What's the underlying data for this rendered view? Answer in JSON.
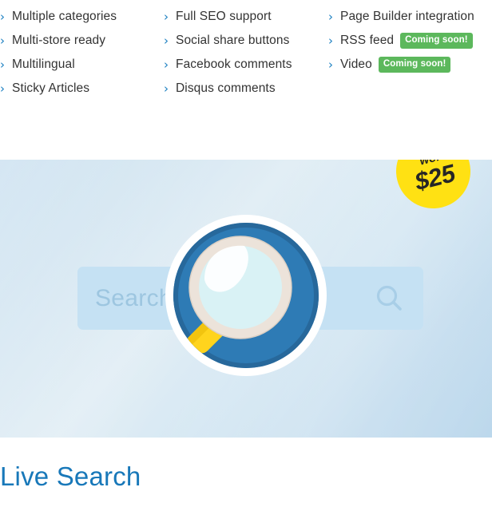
{
  "features": {
    "columns": [
      {
        "items": [
          {
            "label": "Multiple categories",
            "chevron": "›",
            "badge": ""
          },
          {
            "label": "Multi-store ready",
            "chevron": "›",
            "badge": ""
          },
          {
            "label": "Multilingual",
            "chevron": "›",
            "badge": ""
          },
          {
            "label": "Sticky Articles",
            "chevron": "›",
            "badge": ""
          }
        ]
      },
      {
        "items": [
          {
            "label": "Full SEO support",
            "chevron": "›",
            "badge": ""
          },
          {
            "label": "Social share buttons",
            "chevron": "›",
            "badge": ""
          },
          {
            "label": "Facebook comments",
            "chevron": "›",
            "badge": ""
          },
          {
            "label": "Disqus comments",
            "chevron": "›",
            "badge": ""
          }
        ]
      },
      {
        "items": [
          {
            "label": "Page Builder integration",
            "chevron": "›",
            "badge": ""
          },
          {
            "label": "RSS feed",
            "chevron": "›",
            "badge": "Coming soon!"
          },
          {
            "label": "Video",
            "chevron": "›",
            "badge": "Coming soon!"
          }
        ]
      }
    ]
  },
  "banner": {
    "search": {
      "value": "",
      "placeholder": "Search",
      "icon": "search-icon"
    },
    "magnifier_icon": "magnifying-glass-illustration",
    "worth_badge": {
      "label": "worth",
      "amount": "$25"
    }
  },
  "heading": {
    "title": "Live Search"
  },
  "colors": {
    "accent_blue": "#1878b9",
    "chevron_blue": "#1a7fc1",
    "badge_green": "#5cb85c",
    "badge_yellow": "#ffe113",
    "search_field": "#c5e1f3",
    "magnifier_blue": "#2e7bb5",
    "magnifier_lens": "#d9f2f5",
    "magnifier_ring": "#ece3da",
    "magnifier_handle": "#ffd41d",
    "text_dark": "#333333"
  }
}
